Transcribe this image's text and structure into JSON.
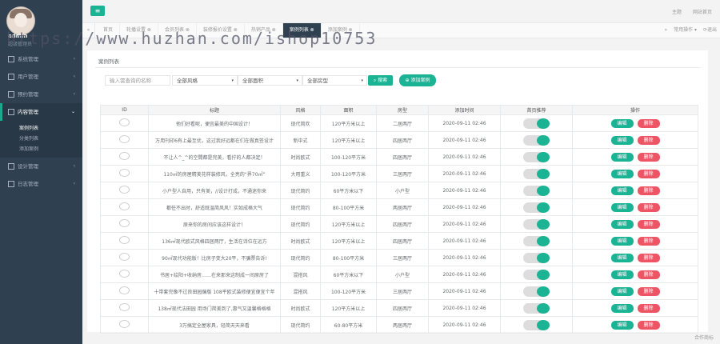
{
  "colors": {
    "accent": "#1ab394",
    "danger": "#ed5565",
    "sidebar": "#2f4050"
  },
  "sidebar": {
    "user_name": "admin",
    "user_role": "超级管理员",
    "menu": [
      {
        "label": "系统管理",
        "icon": "gear-icon"
      },
      {
        "label": "用户管理",
        "icon": "user-icon"
      },
      {
        "label": "预约管理",
        "icon": "calendar-icon"
      },
      {
        "label": "内容管理",
        "icon": "file-icon",
        "active": true,
        "children": [
          "案例列表",
          "分类列表",
          "添加案例"
        ]
      },
      {
        "label": "设计管理",
        "icon": "brush-icon"
      },
      {
        "label": "日志管理",
        "icon": "list-icon"
      }
    ]
  },
  "topbar": {
    "menu_icon": "menu-icon",
    "right_items": [
      "主题",
      "网站首页"
    ]
  },
  "tabbar": {
    "tabs": [
      "首页",
      "轮播设置 ⊗",
      "会员列表 ⊗",
      "装修报价设置 ⊗",
      "热销产品 ⊗",
      "案例列表 ⊗",
      "添加案例 ⊗"
    ],
    "active_index": 5,
    "tools": [
      "常用操作 ▾",
      "⟳退出"
    ]
  },
  "watermark": "https://www.huzhan.com/ishop10753",
  "content": {
    "title": "案例列表",
    "search_placeholder": "输入需查询的名称",
    "filters": [
      "全部风格",
      "全部面积",
      "全部房型"
    ],
    "search_button": "搜索",
    "add_button": "添加案例"
  },
  "table": {
    "headers": [
      "ID",
      "标题",
      "风格",
      "面积",
      "房型",
      "添加时间",
      "首页推荐",
      "操作"
    ],
    "edit_label": "编辑",
    "delete_label": "删除",
    "rows": [
      [
        "",
        "他们好看呢，便宜最美的中国设计！",
        "现代简欢",
        "120平方米以上",
        "二居两厅",
        "2020-09-11 02:46"
      ],
      [
        "",
        "万用刊印6有上最至优，这过我好远都在们在做真签设计",
        "新中式",
        "120平方米以上",
        "四居两厅",
        "2020-09-11 02:46"
      ],
      [
        "",
        "不让人^_^的空間都是完美，看拧的人都决定！",
        "时尚欧式",
        "100-120平方米",
        "四居两厅",
        "2020-09-11 02:46"
      ],
      [
        "",
        "110㎡的房屋精美花样装修风，全亮的“界70㎡”",
        "大用重义",
        "100-120平方米",
        "三居两厅",
        "2020-09-11 02:46"
      ],
      [
        "",
        "小户型人自用，只有美，//设计打成，不通迷你来",
        "现代简约",
        "60平方米以下",
        "小户型",
        "2020-09-11 02:46"
      ],
      [
        "",
        "都任不出时，舒适既温简风风！实如成格大气",
        "现代简约",
        "80-100平方米",
        "两居两厅",
        "2020-09-11 02:46"
      ],
      [
        "",
        "原来你的房间应该这样设计！",
        "现代简约",
        "120平方米以上",
        "四居两厅",
        "2020-09-11 02:46"
      ],
      [
        "",
        "136㎡现代欧式风格四居两厅，生活在诗位在远方",
        "时尚欧式",
        "120平方米以上",
        "四居两厅",
        "2020-09-11 02:46"
      ],
      [
        "",
        "90㎡现代功能版！比房子变大20平，不骗票告诉!",
        "现代简约",
        "80-100平方米",
        "三居两厅",
        "2020-09-11 02:46"
      ],
      [
        "",
        "书居+绘阳+收纳房……在来那来这制成一间原房了",
        "混搭风",
        "60平方米以下",
        "小户型",
        "2020-09-11 02:46"
      ],
      [
        "",
        "十带套完像不过良田园偏版 108平欧式装修便宜便宜个年",
        "混搭风",
        "100-120平方米",
        "三居两厅",
        "2020-09-11 02:46"
      ],
      [
        "",
        "138㎡现代法田园 用场门简美到了,惠气又温馨格格格",
        "时尚欧式",
        "120平方米以上",
        "四居两厅",
        "2020-09-11 02:46"
      ],
      [
        "",
        "3万搞定全屋家具，轻简天天来看",
        "现代简约",
        "60-80平方米",
        "两居两厅",
        "2020-09-11 02:46"
      ]
    ]
  },
  "footer": "合作商标"
}
